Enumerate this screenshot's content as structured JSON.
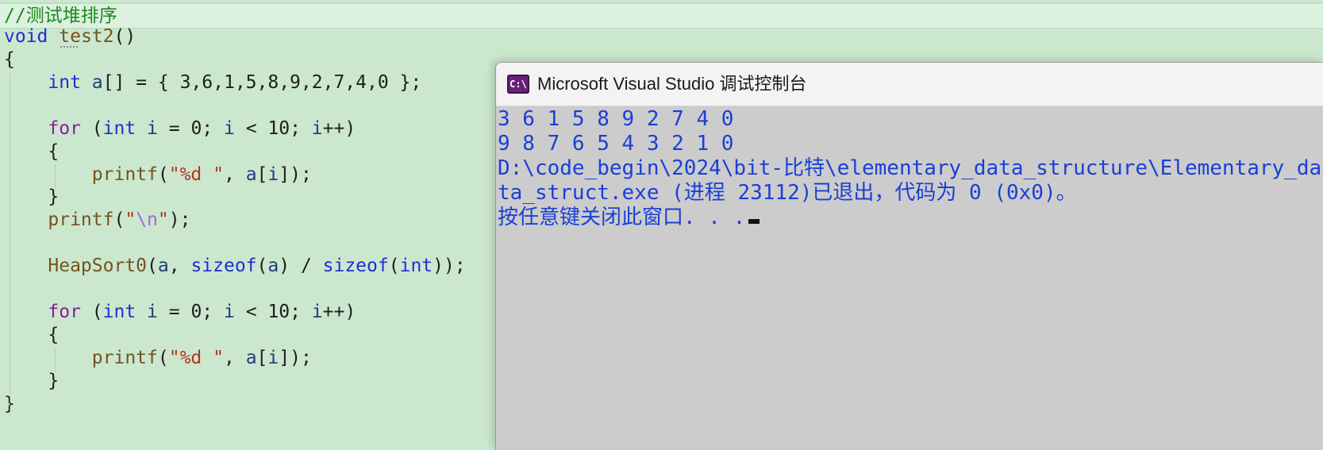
{
  "editor": {
    "lines": [
      {
        "tokens": [
          {
            "t": "//测试堆排序",
            "c": "c-comment"
          }
        ]
      },
      {
        "tokens": [
          {
            "t": "void",
            "c": "c-kw"
          },
          {
            "t": " ",
            "c": "c-plain"
          },
          {
            "t": "test2",
            "c": "c-fn"
          },
          {
            "t": "()",
            "c": "c-plain"
          }
        ]
      },
      {
        "tokens": [
          {
            "t": "{",
            "c": "c-plain"
          }
        ]
      },
      {
        "tokens": [
          {
            "t": "    ",
            "c": "c-plain"
          },
          {
            "t": "int",
            "c": "c-kw"
          },
          {
            "t": " ",
            "c": "c-plain"
          },
          {
            "t": "a",
            "c": "c-var"
          },
          {
            "t": "[] = { 3,6,1,5,8,9,2,7,4,0 };",
            "c": "c-plain"
          }
        ]
      },
      {
        "tokens": []
      },
      {
        "tokens": [
          {
            "t": "    ",
            "c": "c-plain"
          },
          {
            "t": "for",
            "c": "c-flow"
          },
          {
            "t": " (",
            "c": "c-plain"
          },
          {
            "t": "int",
            "c": "c-kw"
          },
          {
            "t": " ",
            "c": "c-plain"
          },
          {
            "t": "i",
            "c": "c-var"
          },
          {
            "t": " = 0; ",
            "c": "c-plain"
          },
          {
            "t": "i",
            "c": "c-var"
          },
          {
            "t": " < 10; ",
            "c": "c-plain"
          },
          {
            "t": "i",
            "c": "c-var"
          },
          {
            "t": "++)",
            "c": "c-plain"
          }
        ]
      },
      {
        "tokens": [
          {
            "t": "    {",
            "c": "c-plain"
          }
        ]
      },
      {
        "tokens": [
          {
            "t": "        ",
            "c": "c-plain"
          },
          {
            "t": "printf",
            "c": "c-fn"
          },
          {
            "t": "(",
            "c": "c-plain"
          },
          {
            "t": "\"%d \"",
            "c": "c-str"
          },
          {
            "t": ", ",
            "c": "c-plain"
          },
          {
            "t": "a",
            "c": "c-var"
          },
          {
            "t": "[",
            "c": "c-plain"
          },
          {
            "t": "i",
            "c": "c-var"
          },
          {
            "t": "]);",
            "c": "c-plain"
          }
        ]
      },
      {
        "tokens": [
          {
            "t": "    }",
            "c": "c-plain"
          }
        ]
      },
      {
        "tokens": [
          {
            "t": "    ",
            "c": "c-plain"
          },
          {
            "t": "printf",
            "c": "c-fn"
          },
          {
            "t": "(",
            "c": "c-plain"
          },
          {
            "t": "\"",
            "c": "c-str"
          },
          {
            "t": "\\n",
            "c": "c-esc"
          },
          {
            "t": "\"",
            "c": "c-str"
          },
          {
            "t": ");",
            "c": "c-plain"
          }
        ]
      },
      {
        "tokens": []
      },
      {
        "tokens": [
          {
            "t": "    ",
            "c": "c-plain"
          },
          {
            "t": "HeapSort0",
            "c": "c-fn"
          },
          {
            "t": "(",
            "c": "c-plain"
          },
          {
            "t": "a",
            "c": "c-var"
          },
          {
            "t": ", ",
            "c": "c-plain"
          },
          {
            "t": "sizeof",
            "c": "c-kw"
          },
          {
            "t": "(",
            "c": "c-plain"
          },
          {
            "t": "a",
            "c": "c-var"
          },
          {
            "t": ") / ",
            "c": "c-plain"
          },
          {
            "t": "sizeof",
            "c": "c-kw"
          },
          {
            "t": "(",
            "c": "c-plain"
          },
          {
            "t": "int",
            "c": "c-kw"
          },
          {
            "t": "));",
            "c": "c-plain"
          }
        ]
      },
      {
        "tokens": []
      },
      {
        "tokens": [
          {
            "t": "    ",
            "c": "c-plain"
          },
          {
            "t": "for",
            "c": "c-flow"
          },
          {
            "t": " (",
            "c": "c-plain"
          },
          {
            "t": "int",
            "c": "c-kw"
          },
          {
            "t": " ",
            "c": "c-plain"
          },
          {
            "t": "i",
            "c": "c-var"
          },
          {
            "t": " = 0; ",
            "c": "c-plain"
          },
          {
            "t": "i",
            "c": "c-var"
          },
          {
            "t": " < 10; ",
            "c": "c-plain"
          },
          {
            "t": "i",
            "c": "c-var"
          },
          {
            "t": "++)",
            "c": "c-plain"
          }
        ]
      },
      {
        "tokens": [
          {
            "t": "    {",
            "c": "c-plain"
          }
        ]
      },
      {
        "tokens": [
          {
            "t": "        ",
            "c": "c-plain"
          },
          {
            "t": "printf",
            "c": "c-fn"
          },
          {
            "t": "(",
            "c": "c-plain"
          },
          {
            "t": "\"%d \"",
            "c": "c-str"
          },
          {
            "t": ", ",
            "c": "c-plain"
          },
          {
            "t": "a",
            "c": "c-var"
          },
          {
            "t": "[",
            "c": "c-plain"
          },
          {
            "t": "i",
            "c": "c-var"
          },
          {
            "t": "]);",
            "c": "c-plain"
          }
        ]
      },
      {
        "tokens": [
          {
            "t": "    }",
            "c": "c-plain"
          }
        ]
      },
      {
        "tokens": [
          {
            "t": "}",
            "c": "c-plain"
          }
        ]
      }
    ]
  },
  "console": {
    "icon_name": "console-app-icon",
    "icon_text": "C:\\",
    "title": "Microsoft Visual Studio 调试控制台",
    "output": [
      "3 6 1 5 8 9 2 7 4 0",
      "9 8 7 6 5 4 3 2 1 0",
      "D:\\code_begin\\2024\\bit-比特\\elementary_data_structure\\Elementary_da",
      "ta_struct.exe (进程 23112)已退出，代码为 0 (0x0)。",
      "按任意键关闭此窗口. . ."
    ]
  },
  "colors": {
    "editor_bg": "#cbe8cf",
    "keyword": "#1f2fd0",
    "control_flow": "#8f1b9c",
    "function": "#74531f",
    "string": "#b0361d",
    "comment": "#1d8a1d",
    "console_text": "#1a3fd6",
    "console_bg": "#cccccc"
  }
}
